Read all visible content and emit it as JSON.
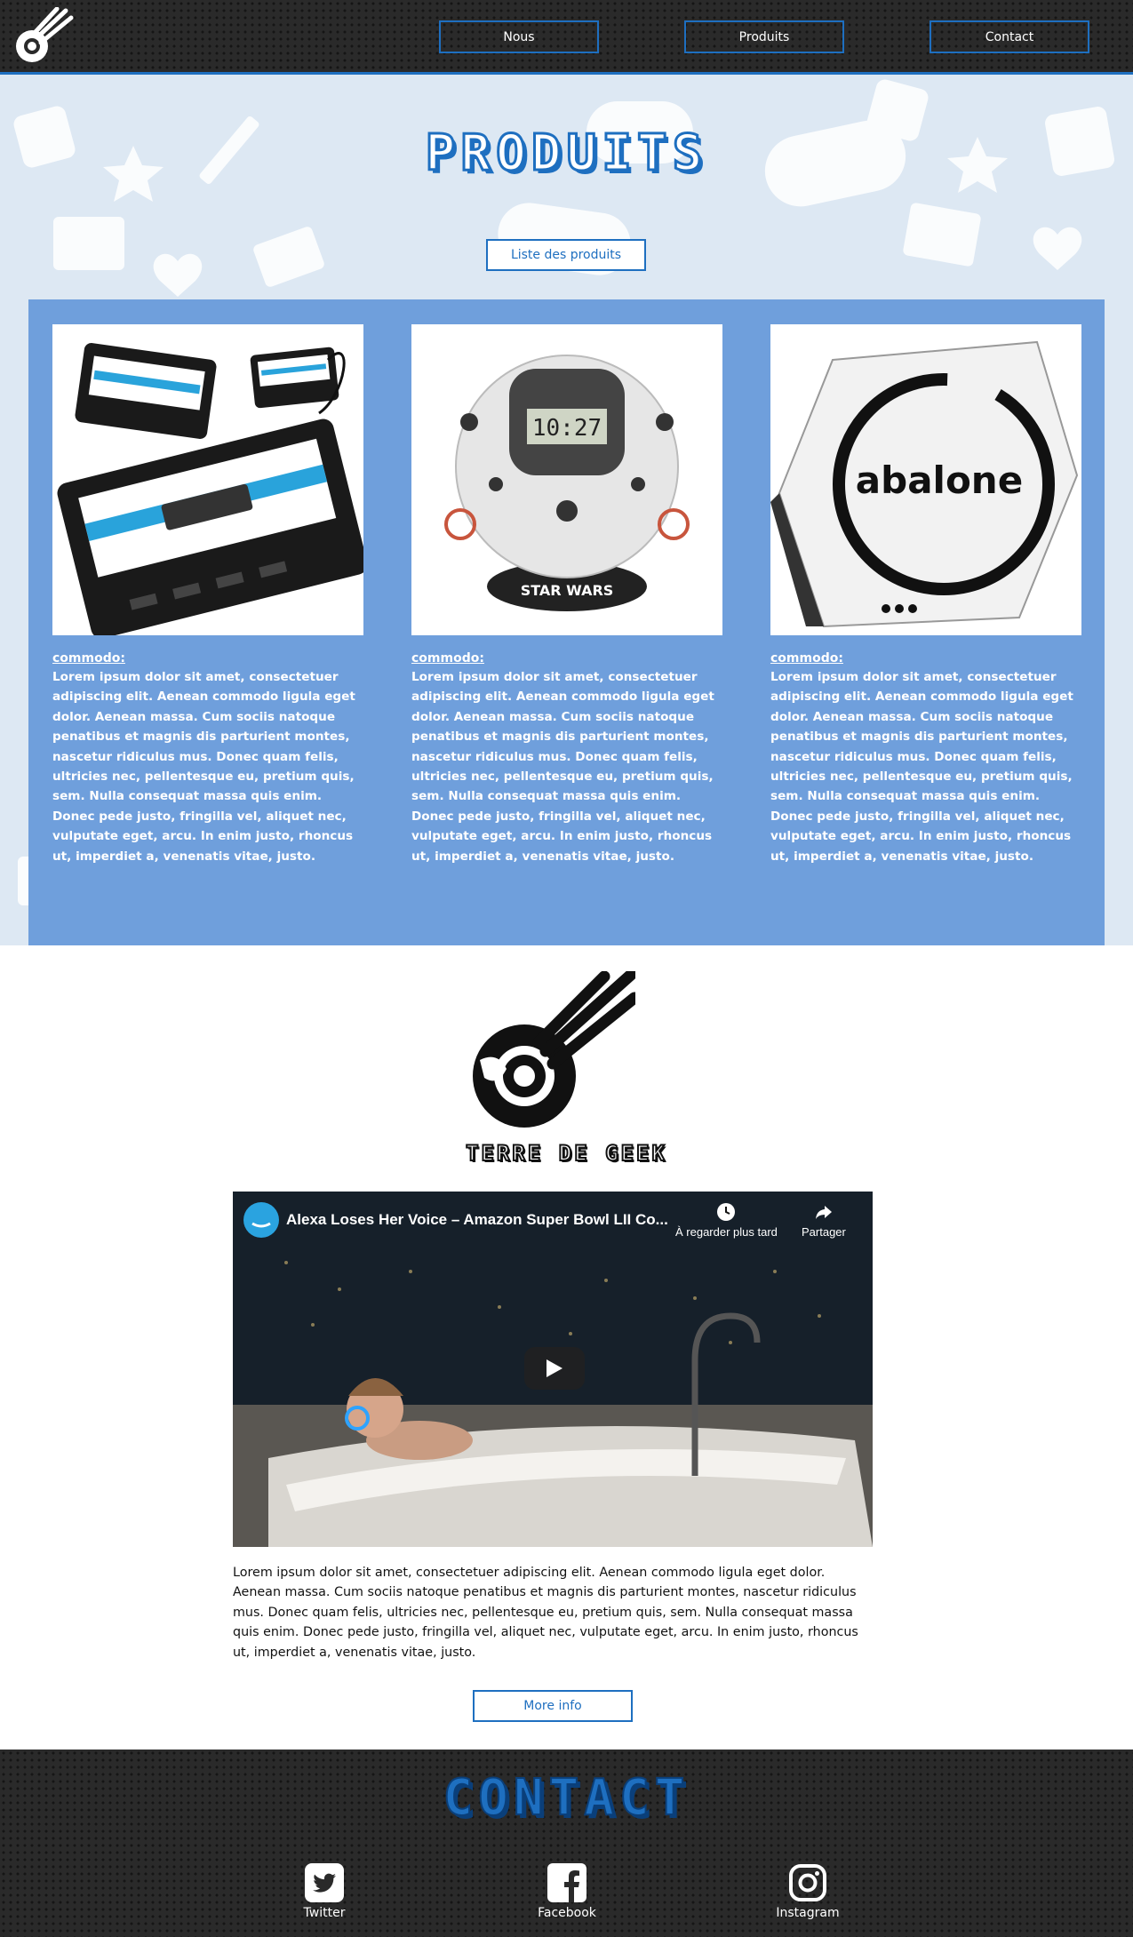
{
  "header": {
    "nav": [
      {
        "label": "Nous"
      },
      {
        "label": "Produits"
      },
      {
        "label": "Contact"
      }
    ]
  },
  "products": {
    "title": "PRODUITS",
    "list_button": "Liste des produits",
    "items": [
      {
        "title": "commodo:",
        "image_icon": "usb-cassette-hub-image",
        "text": "Lorem ipsum dolor sit amet, consectetuer adipiscing elit. Aenean commodo ligula eget dolor. Aenean massa. Cum sociis natoque penatibus et magnis dis parturient montes, nascetur ridiculus mus. Donec quam felis, ultricies nec, pellentesque eu, pretium quis, sem. Nulla consequat massa quis enim. Donec pede justo, fringilla vel, aliquet nec, vulputate eget, arcu. In enim justo, rhoncus ut, imperdiet a, venenatis vitae, justo."
      },
      {
        "title": "commodo:",
        "image_icon": "star-wars-alarm-clock-image",
        "clock_time": "10:27",
        "brand": "STAR WARS",
        "text": "Lorem ipsum dolor sit amet, consectetuer adipiscing elit. Aenean commodo ligula eget dolor. Aenean massa. Cum sociis natoque penatibus et magnis dis parturient montes, nascetur ridiculus mus. Donec quam felis, ultricies nec, pellentesque eu, pretium quis, sem. Nulla consequat massa quis enim. Donec pede justo, fringilla vel, aliquet nec, vulputate eget, arcu. In enim justo, rhoncus ut, imperdiet a, venenatis vitae, justo."
      },
      {
        "title": "commodo:",
        "image_icon": "abalone-board-game-image",
        "brand": "abalone",
        "text": "Lorem ipsum dolor sit amet, consectetuer adipiscing elit. Aenean commodo ligula eget dolor. Aenean massa. Cum sociis natoque penatibus et magnis dis parturient montes, nascetur ridiculus mus. Donec quam felis, ultricies nec, pellentesque eu, pretium quis, sem. Nulla consequat massa quis enim. Donec pede justo, fringilla vel, aliquet nec, vulputate eget, arcu. In enim justo, rhoncus ut, imperdiet a, venenatis vitae, justo."
      }
    ]
  },
  "about": {
    "brand_name": "TERRE DE GEEK",
    "video": {
      "title": "Alexa Loses Her Voice – Amazon Super Bowl LII Co...",
      "watch_later": "À regarder plus tard",
      "share": "Partager"
    },
    "text": "Lorem ipsum dolor sit amet, consectetuer adipiscing elit. Aenean commodo ligula eget dolor. Aenean massa. Cum sociis natoque penatibus et magnis dis parturient montes, nascetur ridiculus mus. Donec quam felis, ultricies nec, pellentesque eu, pretium quis, sem. Nulla consequat massa quis enim. Donec pede justo, fringilla vel, aliquet nec, vulputate eget, arcu. In enim justo, rhoncus ut, imperdiet a, venenatis vitae, justo.",
    "more_button": "More info"
  },
  "contact": {
    "title": "CONTACT",
    "social": [
      {
        "label": "Twitter",
        "icon": "twitter-icon"
      },
      {
        "label": "Facebook",
        "icon": "facebook-icon"
      },
      {
        "label": "Instagram",
        "icon": "instagram-icon"
      }
    ]
  },
  "colors": {
    "accent": "#1e6fc0",
    "panel": "#6f9fdc",
    "pattern_bg": "#dde8f3",
    "dark": "#2a2a2a"
  }
}
